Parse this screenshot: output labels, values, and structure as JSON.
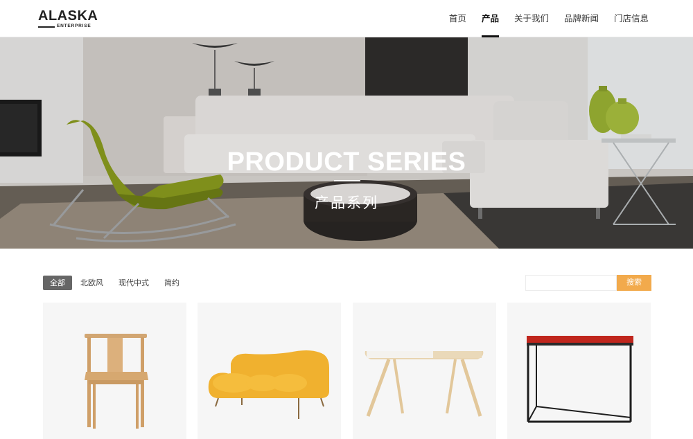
{
  "header": {
    "logo_text": "ALASKA",
    "logo_subtext": "ENTERPRISE",
    "nav": [
      {
        "label": "首页",
        "active": false
      },
      {
        "label": "产品",
        "active": true
      },
      {
        "label": "关于我们",
        "active": false
      },
      {
        "label": "品牌新闻",
        "active": false
      },
      {
        "label": "门店信息",
        "active": false
      }
    ]
  },
  "banner": {
    "title": "PRODUCT SERIES",
    "subtitle": "产品系列"
  },
  "filters": {
    "tabs": [
      {
        "label": "全部",
        "active": true
      },
      {
        "label": "北欧风",
        "active": false
      },
      {
        "label": "现代中式",
        "active": false
      },
      {
        "label": "简约",
        "active": false
      }
    ]
  },
  "search": {
    "value": "",
    "placeholder": "",
    "button_label": "搜索"
  },
  "products": [
    {
      "icon": "wooden-chair-icon"
    },
    {
      "icon": "yellow-sofa-icon"
    },
    {
      "icon": "coffee-table-icon"
    },
    {
      "icon": "red-side-table-icon"
    }
  ],
  "colors": {
    "accent": "#f2aa4c",
    "active_tab": "#666666",
    "nav_text": "#333333"
  }
}
